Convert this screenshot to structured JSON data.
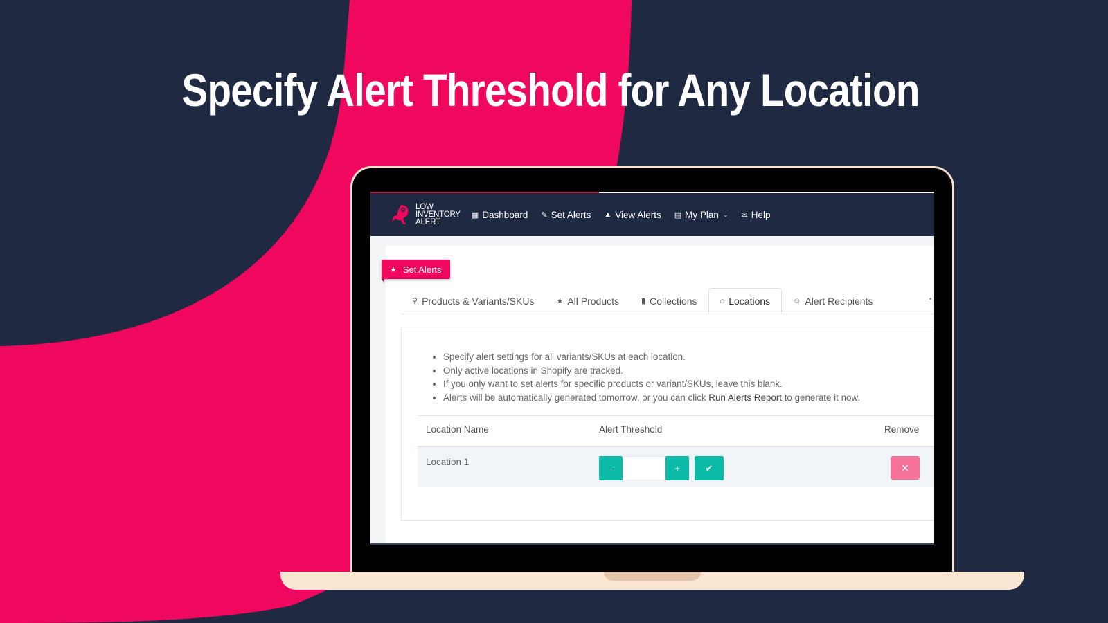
{
  "headline": "Specify Alert Threshold for Any Location",
  "colors": {
    "background": "#1f2942",
    "brand_pink": "#f0085e",
    "teal": "#0bbba8",
    "remove_pink": "#f5729b",
    "laptop_frame": "#fbe6d4"
  },
  "app": {
    "logo": {
      "icon": "parrot-logo-icon",
      "lines": [
        "LOW",
        "INVENTORY",
        "ALERT"
      ]
    },
    "nav": [
      {
        "label": "Dashboard",
        "icon": "dashboard-icon",
        "glyph": "▦"
      },
      {
        "label": "Set Alerts",
        "icon": "magic-wand-icon",
        "glyph": "✎"
      },
      {
        "label": "View Alerts",
        "icon": "warning-icon",
        "glyph": "▲"
      },
      {
        "label": "My Plan",
        "icon": "calendar-icon",
        "glyph": "▤",
        "has_dropdown": true,
        "chevron": "⌄"
      },
      {
        "label": "Help",
        "icon": "mail-icon",
        "glyph": "✉"
      }
    ],
    "section_badge": {
      "label": "Set Alerts",
      "icon": "star-icon",
      "glyph": "★"
    },
    "tabs": [
      {
        "label": "Products & Variants/SKUs",
        "icon": "search-icon",
        "glyph": "⚲",
        "active": false
      },
      {
        "label": "All Products",
        "icon": "star-icon",
        "glyph": "★",
        "active": false
      },
      {
        "label": "Collections",
        "icon": "collections-icon",
        "glyph": "▮",
        "active": false
      },
      {
        "label": "Locations",
        "icon": "home-icon",
        "glyph": "⌂",
        "active": true
      },
      {
        "label": "Alert Recipients",
        "icon": "users-icon",
        "glyph": "☺",
        "active": false
      }
    ],
    "tab_overflow_glyph": "•",
    "info": [
      {
        "text": "Specify alert settings for all variants/SKUs at each location."
      },
      {
        "text": "Only active locations in Shopify are tracked."
      },
      {
        "text": "If you only want to set alerts for specific products or variant/SKUs, leave this blank."
      },
      {
        "before": "Alerts will be automatically generated tomorrow, or you can click ",
        "bold": "Run Alerts Report",
        "after": " to generate it now."
      }
    ],
    "table": {
      "headers": [
        "Location Name",
        "Alert Threshold",
        "Remove"
      ],
      "rows": [
        {
          "location": "Location 1",
          "threshold_value": "",
          "decrement_label": "-",
          "increment_label": "+",
          "save_glyph": "✔",
          "remove_glyph": "✕"
        }
      ]
    }
  }
}
